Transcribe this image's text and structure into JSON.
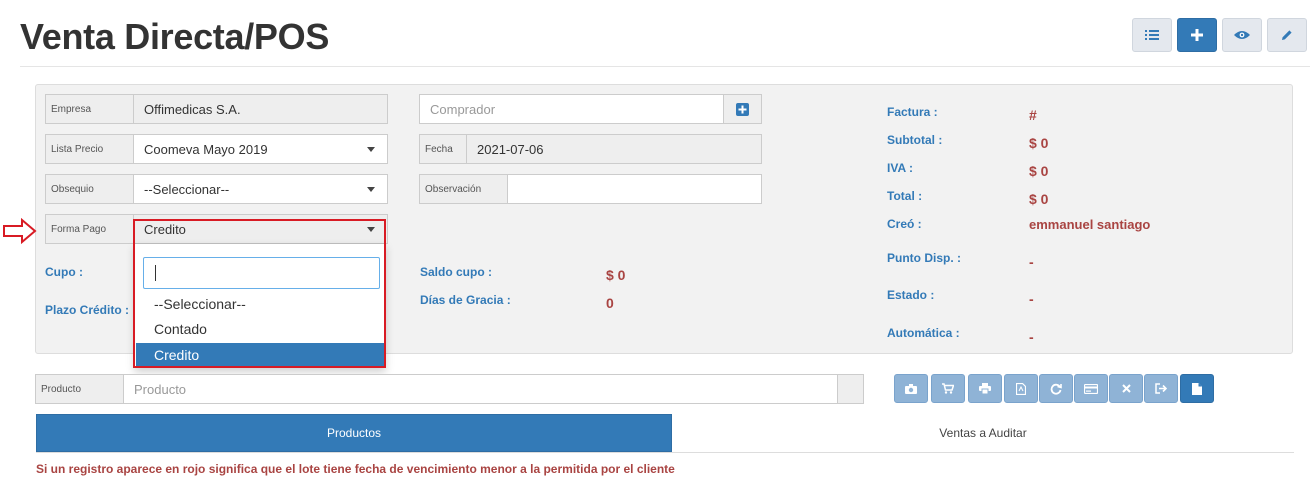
{
  "page": {
    "title": "Venta Directa/POS"
  },
  "toolbar": {
    "buttons": [
      {
        "name": "list-view-button",
        "icon": "list-icon"
      },
      {
        "name": "add-button",
        "icon": "plus-icon"
      },
      {
        "name": "view-button",
        "icon": "eye-icon"
      },
      {
        "name": "edit-button",
        "icon": "pencil-icon"
      }
    ]
  },
  "form": {
    "empresa": {
      "label": "Empresa",
      "value": "Offimedicas S.A."
    },
    "lista_precio": {
      "label": "Lista Precio",
      "value": "Coomeva Mayo 2019"
    },
    "obsequio": {
      "label": "Obsequio",
      "value": "--Seleccionar--"
    },
    "forma_pago": {
      "label": "Forma Pago",
      "value": "Credito"
    },
    "comprador": {
      "placeholder": "Comprador"
    },
    "fecha": {
      "label": "Fecha",
      "value": "2021-07-06"
    },
    "observacion": {
      "label": "Observación",
      "value": ""
    },
    "cupo": {
      "label": "Cupo :"
    },
    "plazo_credito": {
      "label": "Plazo Crédito :"
    },
    "saldo_cupo": {
      "label": "Saldo cupo :",
      "value": "$ 0"
    },
    "dias_gracia": {
      "label": "Días de Gracia :",
      "value": "0"
    },
    "producto": {
      "label": "Producto",
      "placeholder": "Producto"
    }
  },
  "dropdown": {
    "search_value": "",
    "options": [
      "--Seleccionar--",
      "Contado",
      "Credito"
    ],
    "selected_index": 2
  },
  "summary": {
    "factura": {
      "label": "Factura :",
      "value": "#"
    },
    "subtotal": {
      "label": "Subtotal :",
      "value": "$ 0"
    },
    "iva": {
      "label": "IVA :",
      "value": "$ 0"
    },
    "total": {
      "label": "Total :",
      "value": "$ 0"
    },
    "creo": {
      "label": "Creó :",
      "value": "emmanuel santiago"
    },
    "punto_disp": {
      "label": "Punto Disp. :",
      "value": "-"
    },
    "estado": {
      "label": "Estado :",
      "value": "-"
    },
    "automatica": {
      "label": "Automática :",
      "value": "-"
    }
  },
  "actions": {
    "buttons": [
      {
        "name": "camera-button",
        "icon": "camera-icon"
      },
      {
        "name": "cart-button",
        "icon": "cart-icon"
      },
      {
        "name": "print-button",
        "icon": "print-icon"
      },
      {
        "name": "pdf-button",
        "icon": "pdf-icon"
      },
      {
        "name": "refresh-button",
        "icon": "refresh-icon"
      },
      {
        "name": "card-button",
        "icon": "credit-card-icon"
      },
      {
        "name": "cancel-button",
        "icon": "close-icon"
      },
      {
        "name": "exit-button",
        "icon": "sign-out-icon"
      },
      {
        "name": "document-button",
        "icon": "file-icon"
      }
    ]
  },
  "tabs": [
    {
      "label": "Productos",
      "active": true
    },
    {
      "label": "Ventas a Auditar",
      "active": false
    }
  ],
  "notice": "Si un registro aparece en rojo significa que el lote tiene fecha de vencimiento menor a la permitida por el cliente",
  "colors": {
    "primary": "#337ab7",
    "danger": "#a94442",
    "highlight_border": "#d81b24",
    "light_button": "#8fb3d6"
  }
}
